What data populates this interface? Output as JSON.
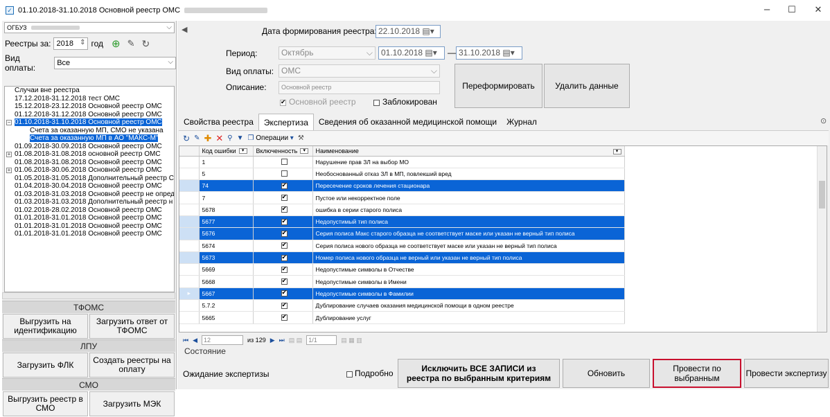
{
  "window": {
    "title": "01.10.2018-31.10.2018 Основной реестр ОМС",
    "minimize": "–",
    "maximize": "☐",
    "close": "✕"
  },
  "left": {
    "org": "ОГБУЗ",
    "year_label": "Реестры за:",
    "year_value": "2018",
    "year_suffix": "год",
    "payment_label": "Вид оплаты:",
    "payment_value": "Все",
    "tree": [
      {
        "text": "Случаи вне реестра",
        "level": 0,
        "sel": false,
        "exp": ""
      },
      {
        "text": "17.12.2018-31.12.2018 тест ОМС",
        "level": 0,
        "sel": false,
        "exp": ""
      },
      {
        "text": "15.12.2018-23.12.2018 Основной реестр ОМС",
        "level": 0,
        "sel": false,
        "exp": ""
      },
      {
        "text": "01.12.2018-31.12.2018 Основной реестр ОМС",
        "level": 0,
        "sel": false,
        "exp": ""
      },
      {
        "text": "01.10.2018-31.10.2018 Основной реестр ОМС",
        "level": 0,
        "sel": true,
        "exp": "−"
      },
      {
        "text": "Счета за оказанную МП, СМО не указана",
        "level": 1,
        "sel": false,
        "exp": ""
      },
      {
        "text": "Счета за оказанную МП в АО \"МАКС-М\"",
        "level": 1,
        "sel": true,
        "exp": ""
      },
      {
        "text": "01.09.2018-30.09.2018 Основной реестр ОМС",
        "level": 0,
        "sel": false,
        "exp": ""
      },
      {
        "text": "01.08.2018-31.08.2018 основной реестр ОМС",
        "level": 0,
        "sel": false,
        "exp": "+"
      },
      {
        "text": "01.08.2018-31.08.2018 Основной реестр ОМС",
        "level": 0,
        "sel": false,
        "exp": ""
      },
      {
        "text": "01.06.2018-30.06.2018 Основной реестр ОМС",
        "level": 0,
        "sel": false,
        "exp": "+"
      },
      {
        "text": "01.05.2018-31.05.2018 Дополнительный реестр С",
        "level": 0,
        "sel": false,
        "exp": ""
      },
      {
        "text": "01.04.2018-30.04.2018 Основной реестр ОМС",
        "level": 0,
        "sel": false,
        "exp": ""
      },
      {
        "text": "01.03.2018-31.03.2018 Основной реестр не опред",
        "level": 0,
        "sel": false,
        "exp": ""
      },
      {
        "text": "01.03.2018-31.03.2018 Дополнительный реестр н",
        "level": 0,
        "sel": false,
        "exp": ""
      },
      {
        "text": "01.02.2018-28.02.2018 Основной реестр ОМС",
        "level": 0,
        "sel": false,
        "exp": ""
      },
      {
        "text": "01.01.2018-31.01.2018 Основной реестр ОМС",
        "level": 0,
        "sel": false,
        "exp": ""
      },
      {
        "text": "01.01.2018-31.01.2018 Основной реестр ОМС",
        "level": 0,
        "sel": false,
        "exp": ""
      },
      {
        "text": "01.01.2018-31.01.2018 Основной реестр ОМС",
        "level": 0,
        "sel": false,
        "exp": ""
      }
    ],
    "tfoms": "ТФОМС",
    "btn_export_id": "Выгрузить на идентификацию",
    "btn_load_tfoms": "Загрузить ответ от ТФОМС",
    "lpu": "ЛПУ",
    "btn_flk": "Загрузить ФЛК",
    "btn_create": "Создать реестры на оплату",
    "smo": "СМО",
    "btn_export_smo": "Выгрузить реестр в СМО",
    "btn_mek": "Загрузить МЭК"
  },
  "form": {
    "date_label": "Дата формирования реестра:",
    "date_value": "22.10.2018",
    "period_label": "Период:",
    "period_month": "Октябрь",
    "period_from": "01.10.2018",
    "period_dash": "—",
    "period_to": "31.10.2018",
    "pay_label": "Вид оплаты:",
    "pay_value": "ОМС",
    "desc_label": "Описание:",
    "desc_value": "Основной реестр",
    "main_reg": "Основной реестр",
    "blocked": "Заблокирован",
    "btn_reform": "Переформировать",
    "btn_delete": "Удалить данные"
  },
  "tabs": [
    "Свойства реестра",
    "Экспертиза",
    "Сведения об оказанной медицинской помощи",
    "Журнал"
  ],
  "toolbar": {
    "ops": "Операции"
  },
  "grid": {
    "headers": [
      "Код ошибки",
      "Включенность",
      "Наименование"
    ],
    "rows": [
      {
        "code": "1",
        "on": false,
        "sel": false,
        "name": "Нарушение прав ЗЛ на выбор МО"
      },
      {
        "code": "5",
        "on": false,
        "sel": false,
        "name": "Необоснованный отказ ЗЛ в МП, повлекший вред"
      },
      {
        "code": "74",
        "on": true,
        "sel": true,
        "name": "Пересечение сроков лечения стационара"
      },
      {
        "code": "7",
        "on": true,
        "sel": false,
        "name": "Пустое или некорректное поле"
      },
      {
        "code": "5678",
        "on": true,
        "sel": false,
        "name": "ошибка в серии старого полиса"
      },
      {
        "code": "5677",
        "on": true,
        "sel": true,
        "name": "Недопустимый тип полиса"
      },
      {
        "code": "5676",
        "on": true,
        "sel": true,
        "name": "Серия полиса Макс старого образца не соответствует маске или указан не верный тип полиса"
      },
      {
        "code": "5674",
        "on": true,
        "sel": false,
        "name": "Серия полиса нового образца не соответствует маске или указан не верный тип полиса"
      },
      {
        "code": "5673",
        "on": true,
        "sel": true,
        "name": "Номер полиса нового образца не верный или указан не верный тип полиса"
      },
      {
        "code": "5669",
        "on": true,
        "sel": false,
        "name": "Недопустимые символы в Отчестве"
      },
      {
        "code": "5668",
        "on": true,
        "sel": false,
        "name": "Недопустимые символы в Имени"
      },
      {
        "code": "5667",
        "on": true,
        "sel": true,
        "name": "Недопустимые символы в Фамилии"
      },
      {
        "code": "5.7.2",
        "on": true,
        "sel": false,
        "name": "Дублирование случаев оказания медицинской помощи в одном реестре"
      },
      {
        "code": "5665",
        "on": true,
        "sel": false,
        "name": "Дублирование услуг"
      }
    ]
  },
  "pager": {
    "current": "12",
    "of": "из 129",
    "page": "1/1"
  },
  "bottom": {
    "state_label": "Состояние",
    "status": "Ожидание экспертизы",
    "detail": "Подробно",
    "btn_exclude": "Исключить ВСЕ ЗАПИСИ из реестра по выбранным критериям",
    "btn_refresh": "Обновить",
    "btn_selected": "Провести по выбранным",
    "btn_expertise": "Провести экспертизу"
  }
}
